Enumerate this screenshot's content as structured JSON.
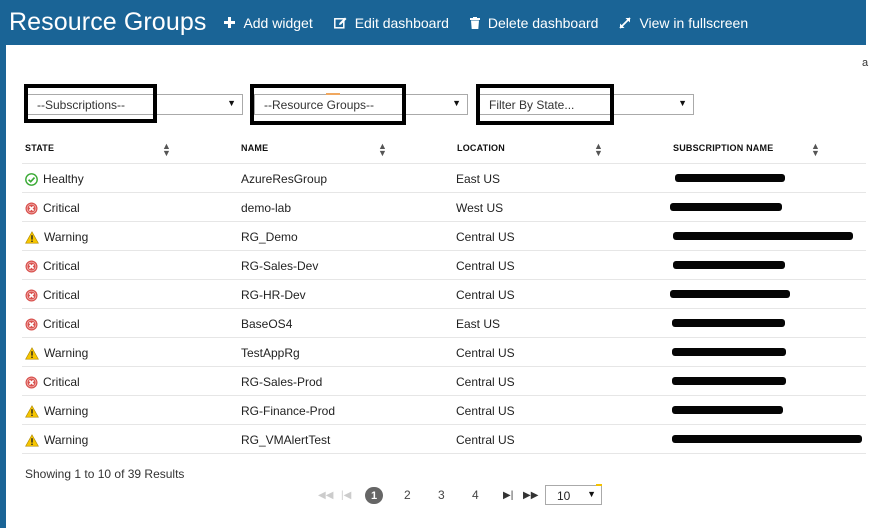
{
  "header": {
    "title": "Resource Groups",
    "buttons": [
      {
        "label": "Add widget",
        "icon": "plus-icon"
      },
      {
        "label": "Edit dashboard",
        "icon": "edit-icon"
      },
      {
        "label": "Delete dashboard",
        "icon": "trash-icon"
      },
      {
        "label": "View in fullscreen",
        "icon": "expand-icon"
      }
    ],
    "edge_char": "a"
  },
  "filters": {
    "subscriptions": "--Subscriptions--",
    "resource_groups": "--Resource Groups--",
    "state": "Filter By State..."
  },
  "table": {
    "columns": [
      "STATE",
      "NAME",
      "LOCATION",
      "SUBSCRIPTION NAME"
    ],
    "rows": [
      {
        "state": "Healthy",
        "name": "AzureResGroup",
        "location": "East US"
      },
      {
        "state": "Critical",
        "name": "demo-lab",
        "location": "West US"
      },
      {
        "state": "Warning",
        "name": "RG_Demo",
        "location": "Central US"
      },
      {
        "state": "Critical",
        "name": "RG-Sales-Dev",
        "location": "Central US"
      },
      {
        "state": "Critical",
        "name": "RG-HR-Dev",
        "location": "Central US"
      },
      {
        "state": "Critical",
        "name": "BaseOS4",
        "location": "East US"
      },
      {
        "state": "Warning",
        "name": "TestAppRg",
        "location": "Central US"
      },
      {
        "state": "Critical",
        "name": "RG-Sales-Prod",
        "location": "Central US"
      },
      {
        "state": "Warning",
        "name": "RG-Finance-Prod",
        "location": "Central US"
      },
      {
        "state": "Warning",
        "name": "RG_VMAlertTest",
        "location": "Central US"
      }
    ]
  },
  "footer": {
    "results": "Showing 1 to 10 of 39 Results",
    "pages": [
      "1",
      "2",
      "3",
      "4"
    ],
    "current_page": "1",
    "page_size": "10"
  },
  "colors": {
    "header_bg": "#1a6496",
    "healthy": "#3aaa35",
    "critical": "#d9534f",
    "warning": "#f7c600"
  }
}
